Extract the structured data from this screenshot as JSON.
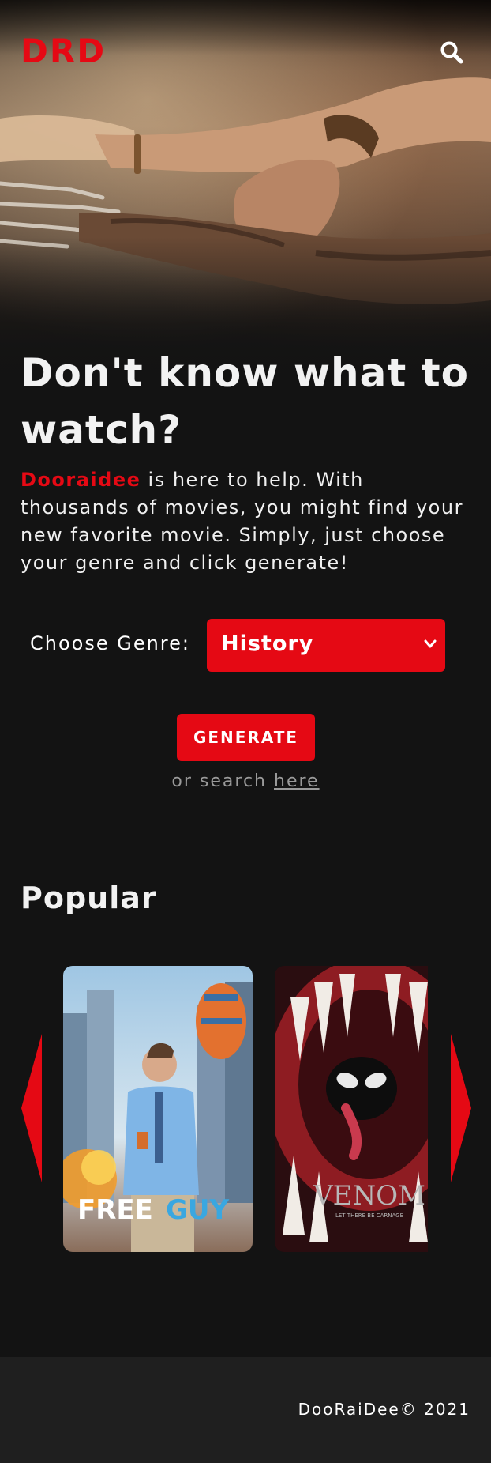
{
  "header": {
    "logo": "DRD",
    "search_icon": "search-icon"
  },
  "hero": {
    "headline": "Don't know what to watch?",
    "brand": "Dooraidee",
    "intro_rest": " is here to help. With thousands of movies, you might find your new favorite movie. Simply, just choose your genre and click generate!"
  },
  "genre": {
    "label": "Choose Genre:",
    "selected": "History"
  },
  "actions": {
    "generate_label": "GENERATE",
    "or_search": "or search ",
    "search_link": "here"
  },
  "popular": {
    "title": "Popular",
    "posters": [
      {
        "title_part1": "FREE",
        "title_part2": "GUY"
      },
      {
        "title": "VENOM",
        "subtitle": "LET THERE BE CARNAGE"
      }
    ],
    "prev_icon": "triangle-left-icon",
    "next_icon": "triangle-right-icon"
  },
  "footer": {
    "copyright": "DooRaiDee© 2021"
  },
  "colors": {
    "accent": "#e50914",
    "background": "#131313",
    "footer": "#1f1f1f"
  }
}
